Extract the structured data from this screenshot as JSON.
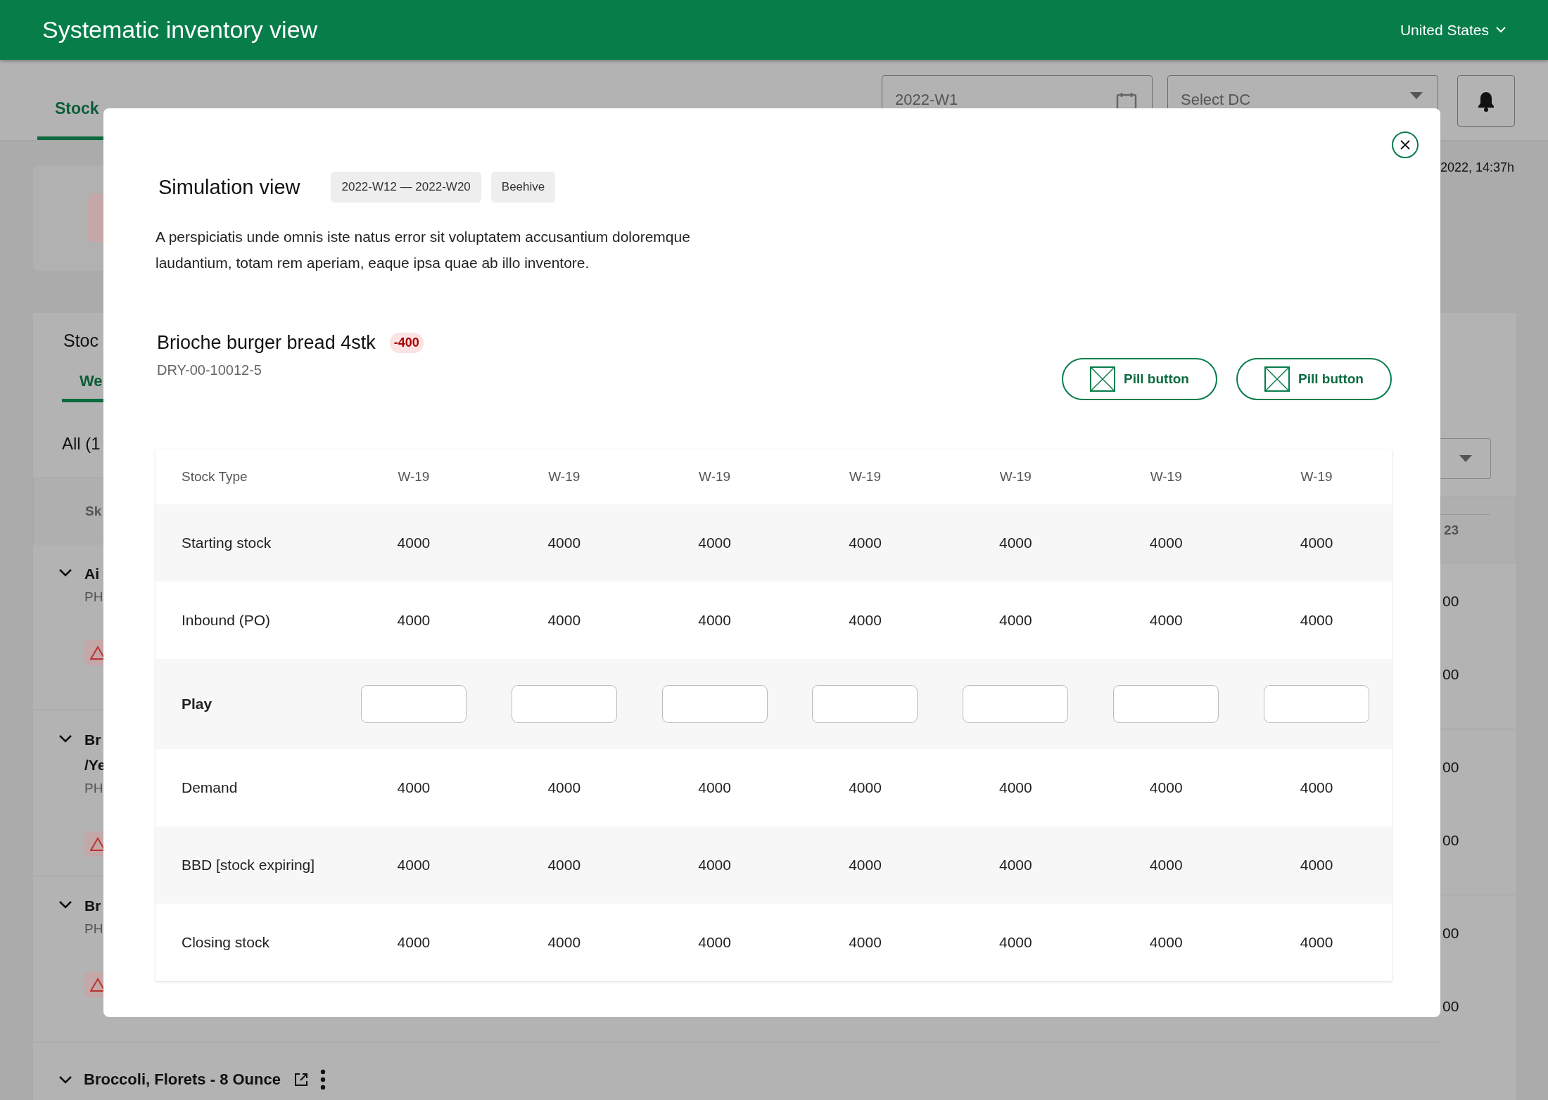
{
  "header": {
    "title": "Systematic inventory view",
    "country": "United States"
  },
  "tabs": [
    {
      "label": "Stock",
      "selected": true
    }
  ],
  "toolbar": {
    "week_field": {
      "value": "2022-W1"
    },
    "dc_select": {
      "placeholder": "Select DC"
    }
  },
  "last_updated": "2022, 14:37h",
  "stock_panel": {
    "title": "Stoc",
    "tabs": [
      {
        "label": "We",
        "selected": true
      }
    ],
    "filter_label": "All (1",
    "column_1": "Sk",
    "column_last": "23",
    "rows": [
      {
        "name_lines": [
          "Ai"
        ],
        "code": "PH",
        "values": [
          "00",
          "00"
        ]
      },
      {
        "name_lines": [
          "Br",
          "/Ye"
        ],
        "code": "PH",
        "values": [
          "00",
          "00"
        ]
      },
      {
        "name_lines": [
          "Br"
        ],
        "code": "PH",
        "values": [
          "00",
          "00"
        ]
      }
    ],
    "last_row": {
      "name": "Broccoli, Florets - 8 Ounce"
    }
  },
  "modal": {
    "title": "Simulation view",
    "tags": [
      "2022-W12 — 2022-W20",
      "Beehive"
    ],
    "description": "A perspiciatis unde omnis iste natus error sit voluptatem accusantium doloremque laudantium, totam rem aperiam, eaque ipsa quae ab illo inventore.",
    "product": {
      "name": "Brioche burger bread 4stk",
      "badge": "-400",
      "sku": "DRY-00-10012-5"
    },
    "buttons": [
      "Pill button",
      "Pill button"
    ],
    "table": {
      "columns": [
        "Stock Type",
        "W-19",
        "W-19",
        "W-19",
        "W-19",
        "W-19",
        "W-19",
        "W-19"
      ],
      "rows": [
        {
          "label": "Starting stock",
          "kind": "values",
          "values": [
            "4000",
            "4000",
            "4000",
            "4000",
            "4000",
            "4000",
            "4000"
          ]
        },
        {
          "label": "Inbound (PO)",
          "kind": "values",
          "values": [
            "4000",
            "4000",
            "4000",
            "4000",
            "4000",
            "4000",
            "4000"
          ]
        },
        {
          "label": "Play",
          "kind": "input"
        },
        {
          "label": "Demand",
          "kind": "values",
          "values": [
            "4000",
            "4000",
            "4000",
            "4000",
            "4000",
            "4000",
            "4000"
          ]
        },
        {
          "label": "BBD [stock expiring]",
          "kind": "values",
          "values": [
            "4000",
            "4000",
            "4000",
            "4000",
            "4000",
            "4000",
            "4000"
          ]
        },
        {
          "label": "Closing stock",
          "kind": "values",
          "values": [
            "4000",
            "4000",
            "4000",
            "4000",
            "4000",
            "4000",
            "4000"
          ]
        }
      ]
    }
  }
}
